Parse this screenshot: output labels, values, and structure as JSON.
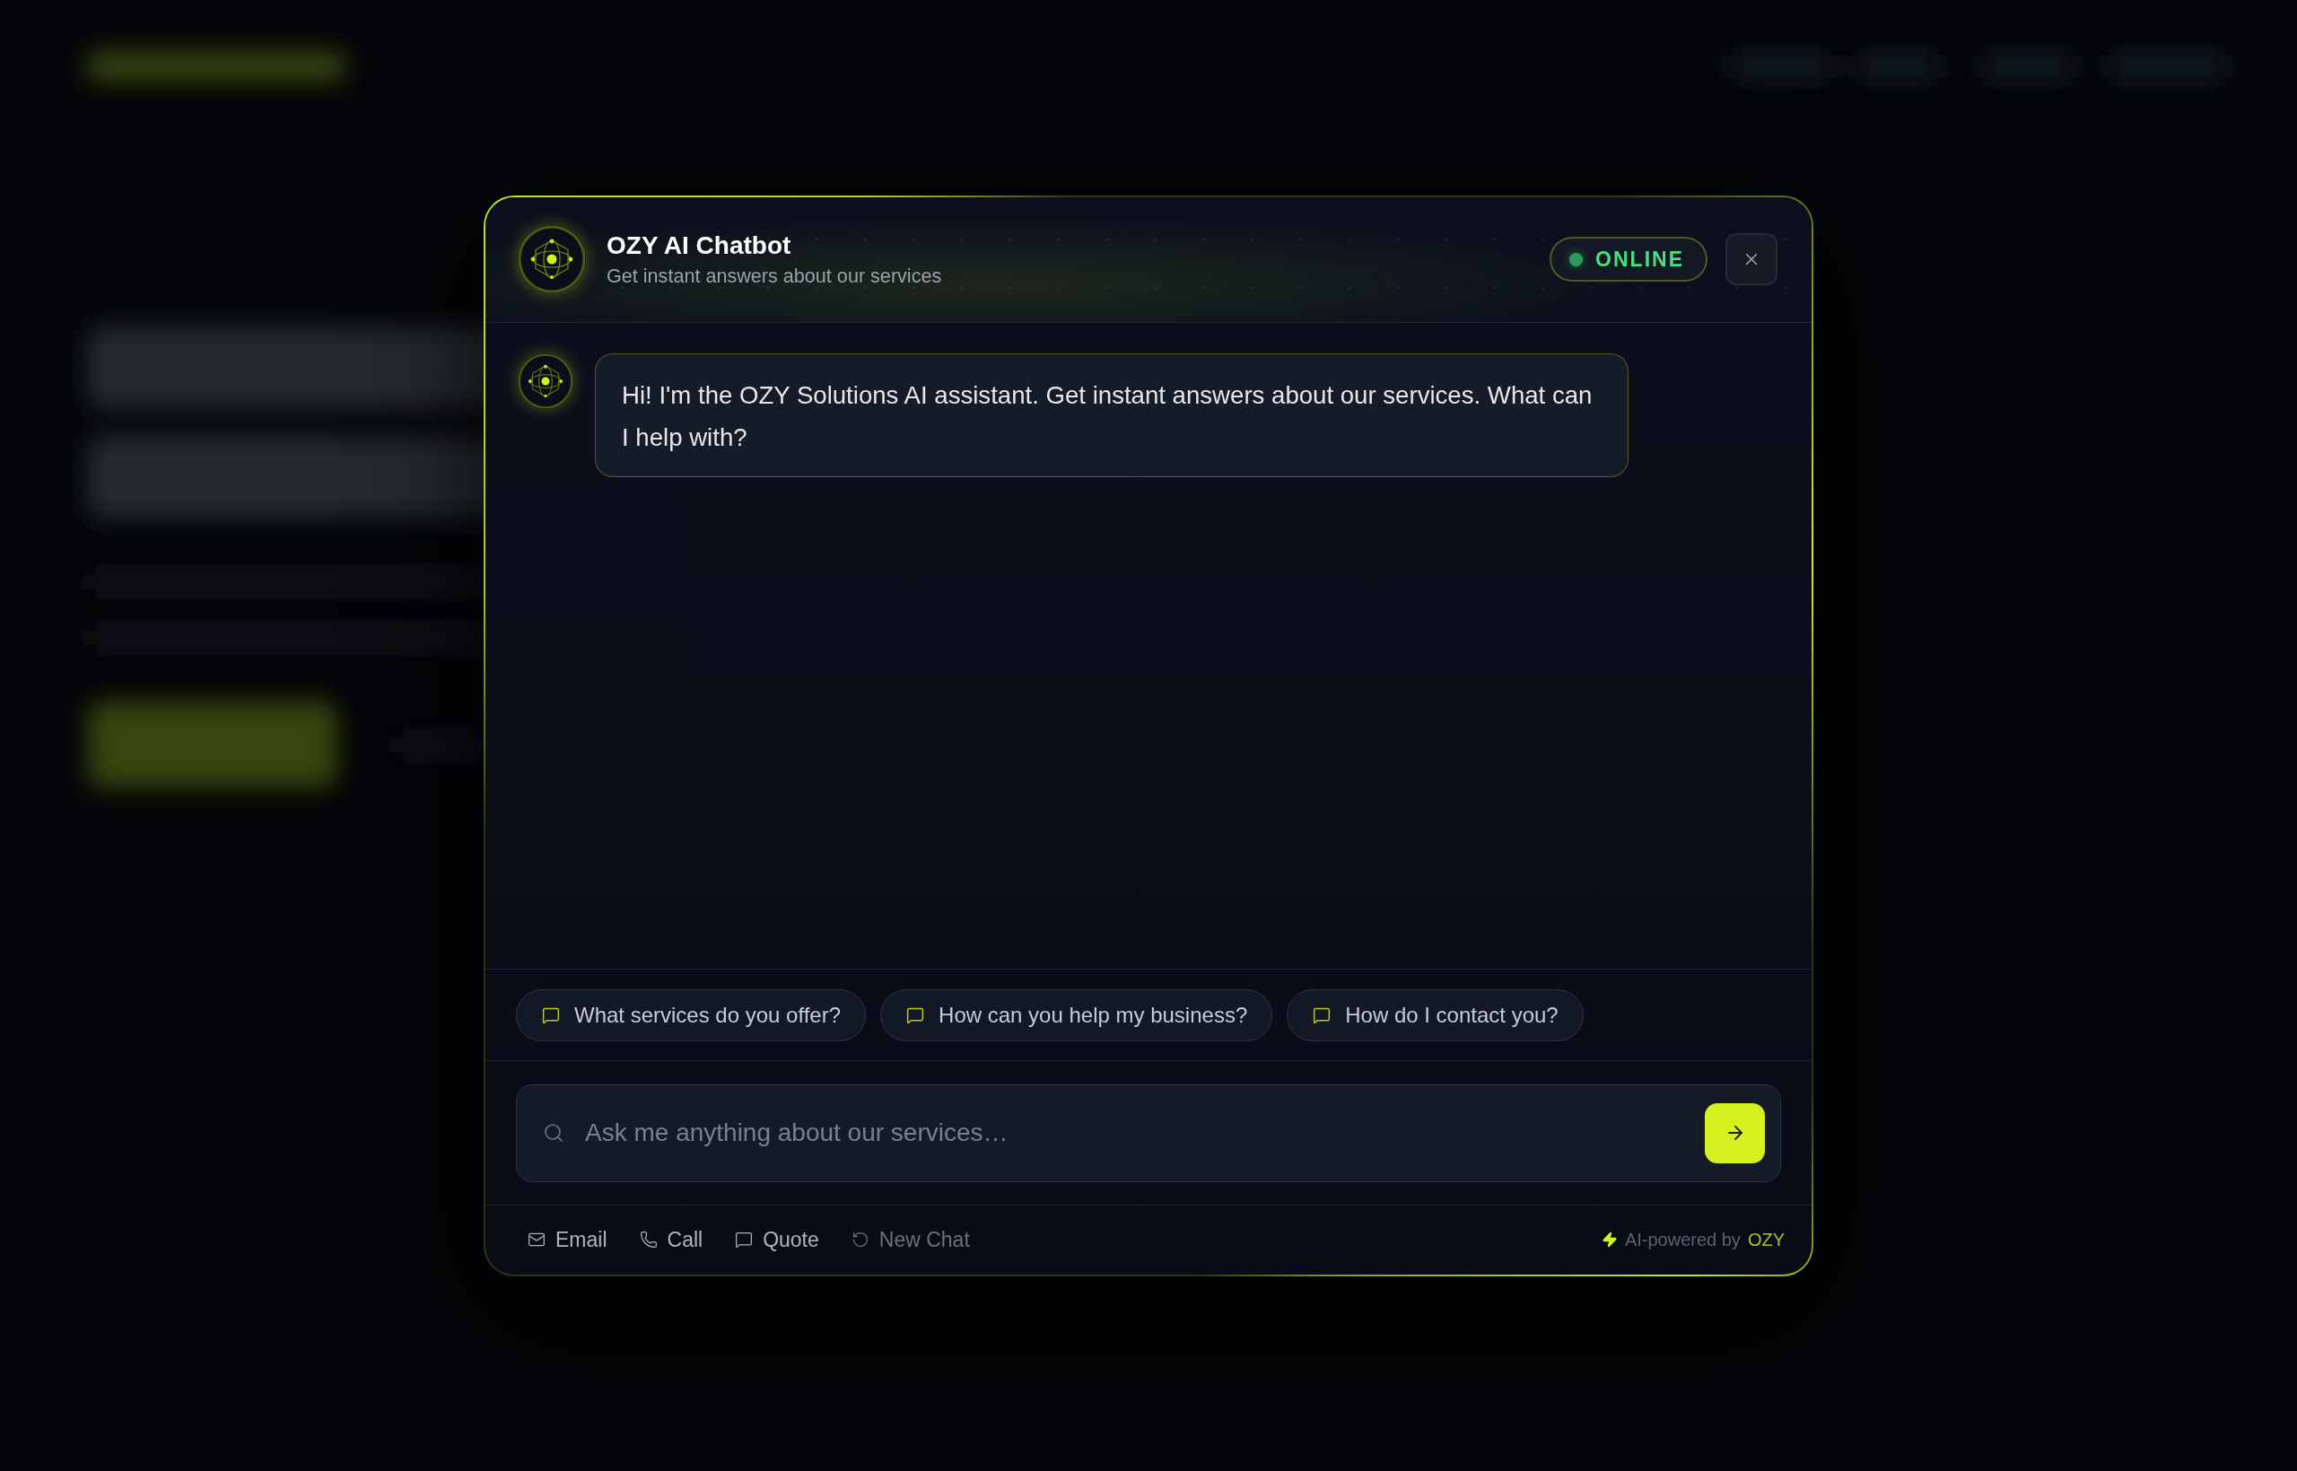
{
  "chat": {
    "title": "OZY AI Chatbot",
    "subtitle": "Get instant answers about our services",
    "status": {
      "label": "ONLINE",
      "online": true
    },
    "messages": [
      {
        "kind": "bot",
        "text": "Hi! I'm the OZY Solutions AI assistant. Get instant answers about our services. What can I help with?"
      }
    ],
    "suggestions": [
      "What services do you offer?",
      "How can you help my business?",
      "How do I contact you?"
    ],
    "input": {
      "placeholder": "Ask me anything about our services…"
    },
    "footer": {
      "actions": [
        {
          "kind": "email",
          "label": "Email",
          "disabled": false
        },
        {
          "kind": "call",
          "label": "Call",
          "disabled": false
        },
        {
          "kind": "quote",
          "label": "Quote",
          "disabled": false
        },
        {
          "kind": "reset",
          "label": "New Chat",
          "disabled": true
        }
      ],
      "powered_by": {
        "label": "AI-powered by",
        "brand": "OZY"
      }
    }
  }
}
